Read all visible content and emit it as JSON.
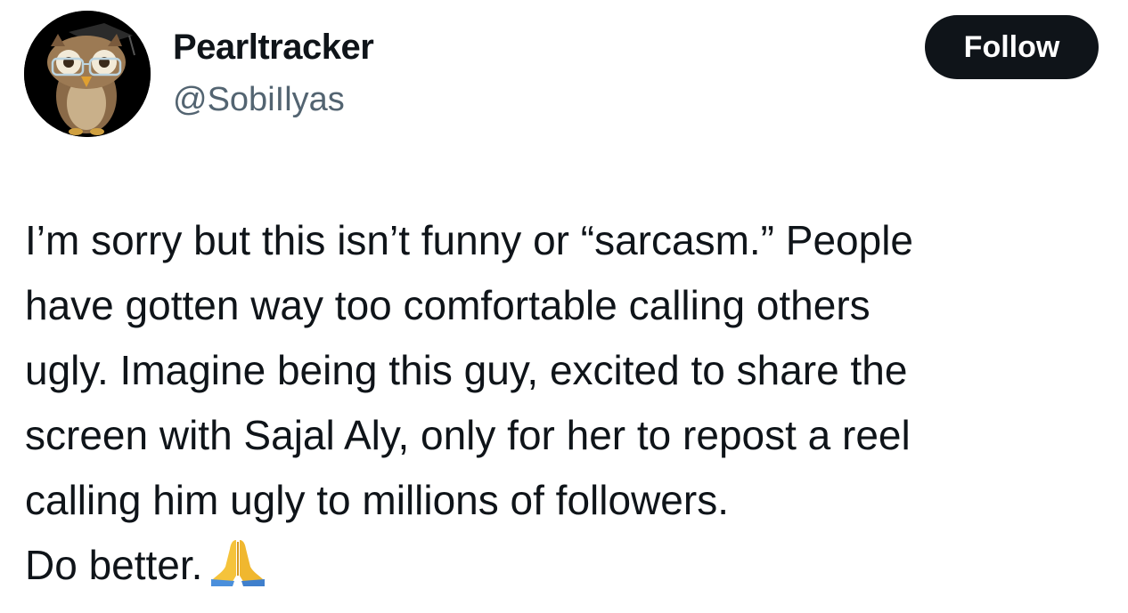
{
  "author": {
    "display_name": "Pearltracker",
    "handle": "@SobiIlyas",
    "avatar_icon": "owl-avatar-icon"
  },
  "actions": {
    "follow_label": "Follow"
  },
  "tweet": {
    "lines": [
      "I’m sorry but this isn’t funny or “sarcasm.” People",
      "have gotten way too comfortable calling others",
      "ugly. Imagine being this guy, excited to share the",
      "screen with Sajal Aly, only for her to repost a reel",
      "calling him ugly to millions of followers.",
      "Do better."
    ],
    "emoji": "folded-hands-icon"
  },
  "colors": {
    "text_primary": "#0f1419",
    "text_secondary": "#536471",
    "button_bg": "#0f1419",
    "button_text": "#ffffff",
    "background": "#ffffff"
  }
}
